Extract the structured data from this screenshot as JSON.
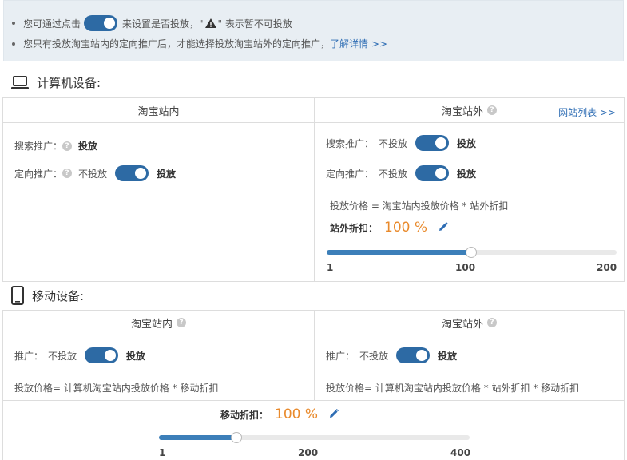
{
  "notice": {
    "line1_pre": "您可通过点击",
    "line1_mid": "来设置是否投放，\"",
    "line1_post": "\" 表示暂不可投放",
    "line2_text": "您只有投放淘宝站内的定向推广后，才能选择投放淘宝站外的定向推广，",
    "line2_link": "了解详情 >>"
  },
  "computer": {
    "title": "计算机设备:",
    "inside": {
      "header": "淘宝站内",
      "search_label": "搜索推广：",
      "search_value": "投放",
      "target_label": "定向推广：",
      "target_off": "不投放",
      "target_on": "投放"
    },
    "outside": {
      "header": "淘宝站外",
      "site_list_link": "网站列表 >>",
      "search_label": "搜索推广：",
      "search_off": "不投放",
      "search_on": "投放",
      "target_label": "定向推广：",
      "target_off": "不投放",
      "target_on": "投放",
      "formula": "投放价格 = 淘宝站内投放价格 * 站外折扣",
      "discount_label": "站外折扣：",
      "discount_value": "100 %",
      "slider": {
        "min": "1",
        "mid": "100",
        "max": "200",
        "value": 100,
        "range_min": 1,
        "range_max": 200
      }
    }
  },
  "mobile": {
    "title": "移动设备:",
    "inside": {
      "header": "淘宝站内",
      "promo_label": "推广：",
      "promo_off": "不投放",
      "promo_on": "投放",
      "formula": "投放价格= 计算机淘宝站内投放价格 * 移动折扣"
    },
    "outside": {
      "header": "淘宝站外",
      "promo_label": "推广：",
      "promo_off": "不投放",
      "promo_on": "投放",
      "formula": "投放价格= 计算机淘宝站内投放价格 * 站外折扣 * 移动折扣"
    },
    "discount_label": "移动折扣：",
    "discount_value": "100 %",
    "slider": {
      "min": "1",
      "mid": "200",
      "max": "400",
      "value": 100,
      "range_min": 1,
      "range_max": 400
    }
  },
  "colors": {
    "accent": "#2d6aa4",
    "orange": "#e98a2c",
    "notice_bg": "#e8eef3"
  }
}
